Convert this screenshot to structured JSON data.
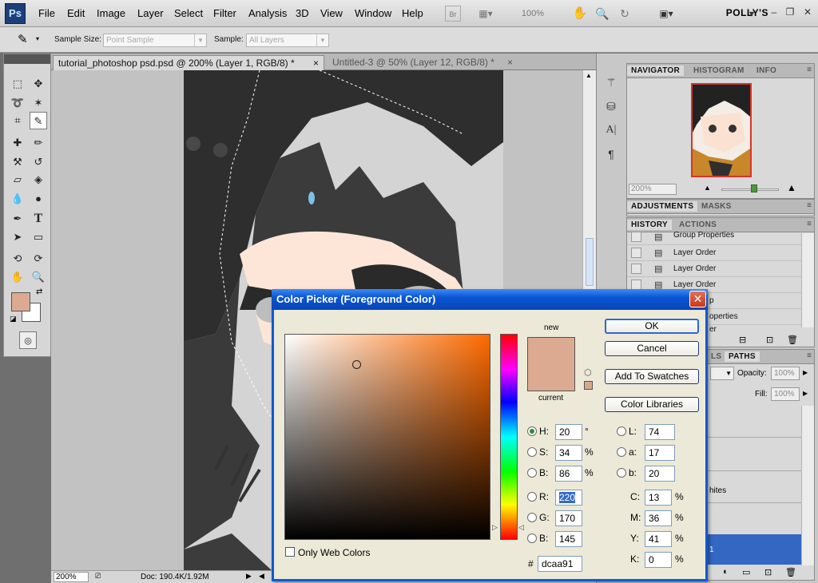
{
  "app": {
    "logo": "Ps",
    "workspace": "POLLY'S",
    "zoom_readout": "100%"
  },
  "menu": [
    "File",
    "Edit",
    "Image",
    "Layer",
    "Select",
    "Filter",
    "Analysis",
    "3D",
    "View",
    "Window",
    "Help"
  ],
  "toolbar_icons": [
    "bridge-icon",
    "screen-mode-icon",
    "hand-icon",
    "zoom-icon",
    "rotate-icon",
    "arrange-icon"
  ],
  "options": {
    "sample_size_label": "Sample Size:",
    "sample_size_value": "Point Sample",
    "sample_label": "Sample:",
    "sample_value": "All Layers"
  },
  "tabs": [
    {
      "label": "tutorial_photoshop psd.psd @ 200% (Layer 1, RGB/8) *",
      "close": "×"
    },
    {
      "label": "Untitled-3 @ 50% (Layer 12, RGB/8) *",
      "close": "×"
    }
  ],
  "status": {
    "zoom": "200%",
    "doc": "Doc: 190.4K/1.92M"
  },
  "navigator": {
    "tabs": [
      "NAVIGATOR",
      "HISTOGRAM",
      "INFO"
    ],
    "zoom": "200%"
  },
  "adjustments": {
    "tabs": [
      "ADJUSTMENTS",
      "MASKS"
    ]
  },
  "history": {
    "tabs": [
      "HISTORY",
      "ACTIONS"
    ],
    "rows": [
      "Group Properties",
      "Layer Order",
      "Layer Order",
      "Layer Order",
      "p",
      "operties",
      "er"
    ]
  },
  "layers": {
    "tabs": [
      "LS",
      "PATHS"
    ],
    "opacity_label": "Opacity:",
    "opacity": "100%",
    "fill_label": "Fill:",
    "fill": "100%",
    "row_text": "hites",
    "row_sel": "1"
  },
  "picker": {
    "title": "Color Picker (Foreground Color)",
    "close": "✕",
    "new_label": "new",
    "current_label": "current",
    "buttons": {
      "ok": "OK",
      "cancel": "Cancel",
      "swatches": "Add To Swatches",
      "libraries": "Color Libraries"
    },
    "hsb": [
      {
        "label": "H:",
        "value": "20",
        "unit": "°"
      },
      {
        "label": "S:",
        "value": "34",
        "unit": "%"
      },
      {
        "label": "B:",
        "value": "86",
        "unit": "%"
      }
    ],
    "rgb": [
      {
        "label": "R:",
        "value": "220"
      },
      {
        "label": "G:",
        "value": "170"
      },
      {
        "label": "B:",
        "value": "145"
      }
    ],
    "lab": [
      {
        "label": "L:",
        "value": "74"
      },
      {
        "label": "a:",
        "value": "17"
      },
      {
        "label": "b:",
        "value": "20"
      }
    ],
    "cmyk": [
      {
        "label": "C:",
        "value": "13",
        "unit": "%"
      },
      {
        "label": "M:",
        "value": "36",
        "unit": "%"
      },
      {
        "label": "Y:",
        "value": "41",
        "unit": "%"
      },
      {
        "label": "K:",
        "value": "0",
        "unit": "%"
      }
    ],
    "hex_prefix": "#",
    "hex": "dcaa91",
    "web_only_label": "Only Web Colors",
    "color": "#dcaa91"
  }
}
